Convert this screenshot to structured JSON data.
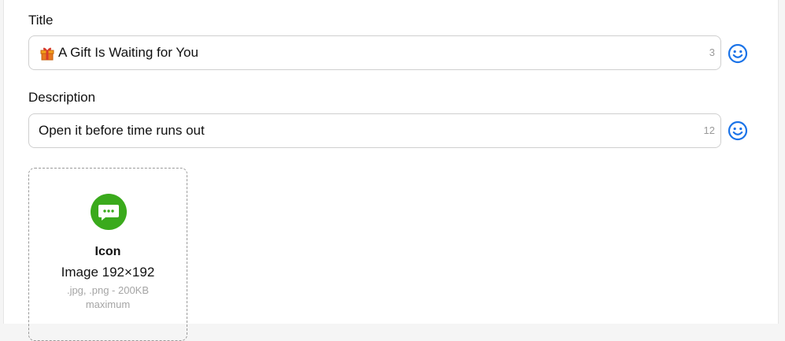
{
  "title_field": {
    "label": "Title",
    "value": "A Gift Is Waiting for You",
    "prefix_icon": "gift-icon",
    "counter": "3"
  },
  "description_field": {
    "label": "Description",
    "value": "Open it before time runs out",
    "counter": "12"
  },
  "icon_upload": {
    "title": "Icon",
    "dimensions": "Image 192×192",
    "hint": ".jpg, .png - 200KB maximum",
    "icon": "chat-bubble-icon"
  },
  "colors": {
    "emoji_button": "#1a73e8",
    "app_icon_green": "#3aaa1c"
  }
}
